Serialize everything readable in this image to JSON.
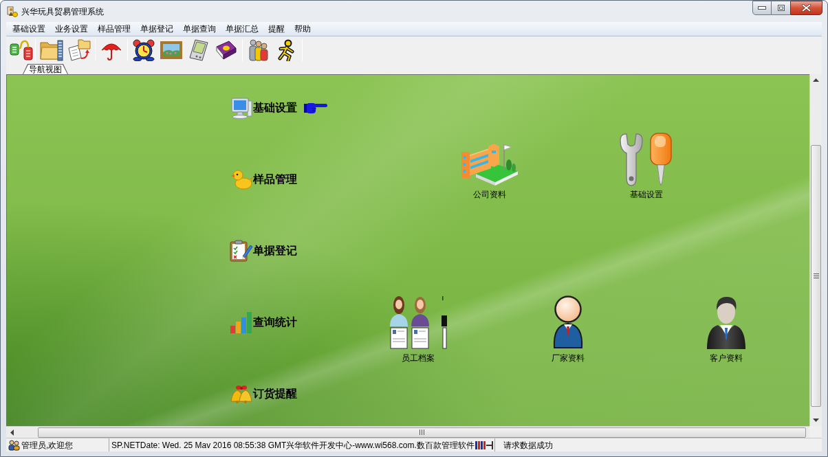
{
  "window": {
    "title": "兴华玩具贸易管理系统"
  },
  "menu": [
    "基础设置",
    "业务设置",
    "样品管理",
    "单据登记",
    "单据查询",
    "单据汇总",
    "提醒",
    "帮助"
  ],
  "tabs": [
    {
      "label": "导航视图",
      "selected": true
    }
  ],
  "nav": [
    {
      "label": "基础设置",
      "selected": true
    },
    {
      "label": "样品管理",
      "selected": false
    },
    {
      "label": "单据登记",
      "selected": false
    },
    {
      "label": "查询统计",
      "selected": false
    },
    {
      "label": "订货提醒",
      "selected": false
    }
  ],
  "launcher": {
    "rows": [
      {
        "items": [
          {
            "label": "公司资料"
          },
          {
            "label": "基础设置"
          }
        ]
      },
      {
        "items": [
          {
            "label": "员工档案"
          },
          {
            "label": "厂家资料"
          },
          {
            "label": "客户资料"
          }
        ]
      }
    ]
  },
  "status_bar": {
    "user": "管理员,欢迎您",
    "message": "SP.NETDate: Wed. 25 Mav 2016 08:55:38 GMT兴华软件开发中心-www.wi568.com.数百款管理软件",
    "status": "请求数据成功"
  }
}
